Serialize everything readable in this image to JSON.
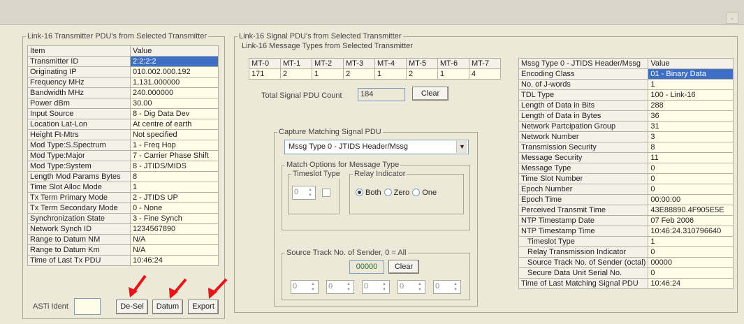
{
  "left_panel": {
    "title": "Link-16 Transmitter PDU's from Selected Transmitter",
    "header": {
      "item": "Item",
      "value": "Value"
    },
    "rows": [
      {
        "item": "Transmitter ID",
        "value": "2:2:2:2"
      },
      {
        "item": "Originating IP",
        "value": "010.002.000.192"
      },
      {
        "item": "Frequency MHz",
        "value": "1,131.000000"
      },
      {
        "item": "Bandwidth MHz",
        "value": "240.000000"
      },
      {
        "item": "Power dBm",
        "value": "30.00"
      },
      {
        "item": "Input Source",
        "value": "8 - Dig Data Dev"
      },
      {
        "item": "Location Lat-Lon",
        "value": "At centre of earth"
      },
      {
        "item": "Height Ft-Mtrs",
        "value": "Not specified"
      },
      {
        "item": "Mod Type:S.Spectrum",
        "value": "1 - Freq Hop"
      },
      {
        "item": "Mod Type:Major",
        "value": "7 - Carrier Phase Shift"
      },
      {
        "item": "Mod Type:System",
        "value": "8 - JTIDS/MIDS"
      },
      {
        "item": "Length Mod Params Bytes",
        "value": "8"
      },
      {
        "item": "Time Slot Alloc Mode",
        "value": "1"
      },
      {
        "item": "Tx Term Primary Mode",
        "value": "2 - JTIDS UP"
      },
      {
        "item": "Tx Term Secondary Mode",
        "value": "0 - None"
      },
      {
        "item": "Synchronization State",
        "value": "3 - Fine Synch"
      },
      {
        "item": "Network Synch ID",
        "value": "1234567890"
      },
      {
        "item": "Range to Datum NM",
        "value": "N/A"
      },
      {
        "item": "Range to Datum Km",
        "value": "N/A"
      },
      {
        "item": "Time of Last Tx PDU",
        "value": "10:46:24"
      }
    ],
    "asti_label": "ASTi Ident",
    "asti_value": "",
    "buttons": {
      "desel": "De-Sel",
      "datum": "Datum",
      "export": "Export"
    }
  },
  "signal_panel": {
    "title": "Link-16 Signal PDU's from Selected Transmitter",
    "msg_types_title": "Link-16 Message Types from Selected Transmitter",
    "mt_headers": [
      "MT-0",
      "MT-1",
      "MT-2",
      "MT-3",
      "MT-4",
      "MT-5",
      "MT-6",
      "MT-7"
    ],
    "mt_values": [
      "171",
      "2",
      "1",
      "2",
      "1",
      "2",
      "1",
      "4"
    ],
    "total_label": "Total Signal PDU Count",
    "total_value": "184",
    "clear_label": "Clear",
    "capture": {
      "title": "Capture Matching Signal PDU",
      "dropdown_value": "Mssg Type 0 - JTIDS Header/Mssg",
      "match_title": "Match Options for Message Type",
      "timeslot_title": "Timeslot Type",
      "timeslot_value": "0",
      "relay_title": "Relay Indicator",
      "relay_options": [
        "Both",
        "Zero",
        "One"
      ],
      "relay_selected": "Both",
      "source_title": "Source Track No. of Sender, 0 = All",
      "source_value": "00000",
      "source_clear": "Clear",
      "spinners": [
        "0",
        "0",
        "0",
        "0",
        "0"
      ]
    }
  },
  "detail_table": {
    "header": {
      "item": "Mssg Type 0 - JTIDS Header/Mssg",
      "value": "Value"
    },
    "rows": [
      {
        "item": "Encoding Class",
        "value": "01 - Binary Data",
        "selected": true
      },
      {
        "item": "No. of J-words",
        "value": "1"
      },
      {
        "item": "TDL Type",
        "value": "100 - Link-16"
      },
      {
        "item": "Length of Data in Bits",
        "value": "288"
      },
      {
        "item": "Length of Data in Bytes",
        "value": "36"
      },
      {
        "item": "Network Partcipation Group",
        "value": "31"
      },
      {
        "item": "Network Number",
        "value": "3"
      },
      {
        "item": "Transmission Security",
        "value": "8"
      },
      {
        "item": "Message Security",
        "value": "11"
      },
      {
        "item": "Message Type",
        "value": "0"
      },
      {
        "item": "Time Slot Number",
        "value": "0"
      },
      {
        "item": "Epoch Number",
        "value": "0"
      },
      {
        "item": "Epoch Time",
        "value": "00:00:00"
      },
      {
        "item": "Perceived Transmit Time",
        "value": "43E88890.4F905E5E"
      },
      {
        "item": "NTP Timestamp Date",
        "value": "07 Feb 2006"
      },
      {
        "item": "NTP Timestamp Time",
        "value": "10:46:24.310796640"
      },
      {
        "item": "Timeslot Type",
        "value": "1",
        "indent": true
      },
      {
        "item": "Relay Transmission Indicator",
        "value": "0",
        "indent": true
      },
      {
        "item": "Source Track No. of Sender (octal)",
        "value": "00000",
        "indent": true
      },
      {
        "item": "Secure Data Unit Serial No.",
        "value": "0",
        "indent": true
      },
      {
        "item": "Time of Last Matching Signal PDU",
        "value": "10:46:24"
      }
    ]
  },
  "colors": {
    "selected": "#3d6fc6",
    "annotation_arrow": "#e8141a"
  }
}
